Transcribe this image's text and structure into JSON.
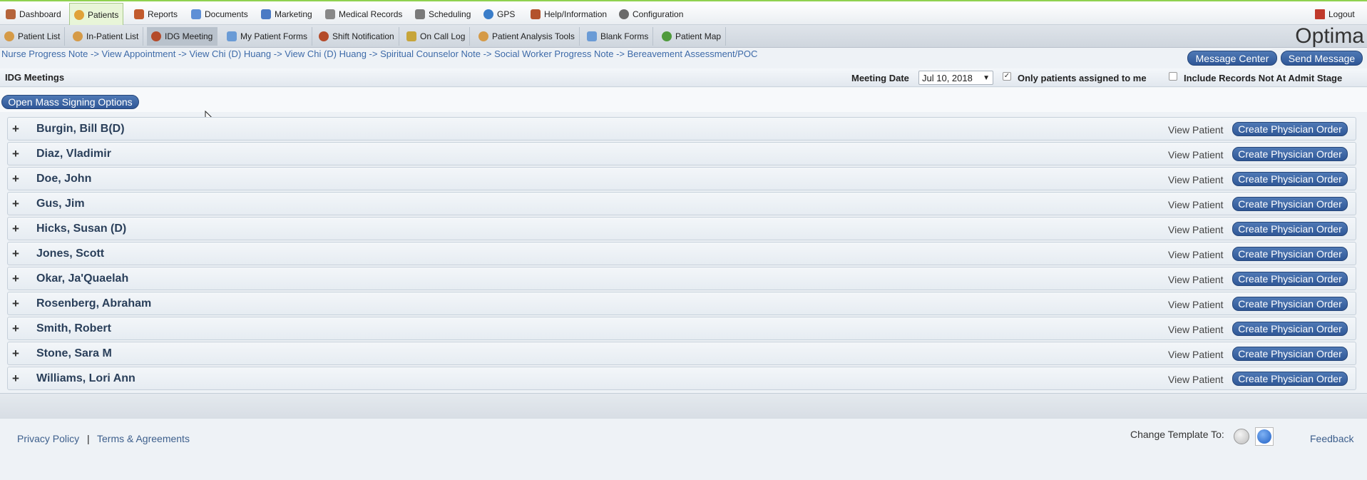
{
  "top_nav": [
    {
      "label": "Dashboard",
      "icon": "house-icon",
      "color": "#b5643b",
      "active": false
    },
    {
      "label": "Patients",
      "icon": "patient-icon",
      "color": "#e0a23a",
      "active": true
    },
    {
      "label": "Reports",
      "icon": "bar-chart-icon",
      "color": "#c25b2d",
      "active": false
    },
    {
      "label": "Documents",
      "icon": "documents-icon",
      "color": "#5e8fd6",
      "active": false
    },
    {
      "label": "Marketing",
      "icon": "marketing-icon",
      "color": "#4b7ac4",
      "active": false
    },
    {
      "label": "Medical Records",
      "icon": "medical-records-icon",
      "color": "#888888",
      "active": false
    },
    {
      "label": "Scheduling",
      "icon": "scheduling-icon",
      "color": "#7a7a7a",
      "active": false
    },
    {
      "label": "GPS",
      "icon": "globe-icon",
      "color": "#3a7dc9",
      "active": false
    },
    {
      "label": "Help/Information",
      "icon": "person-icon",
      "color": "#b3522c",
      "active": false
    },
    {
      "label": "Configuration",
      "icon": "gear-icon",
      "color": "#6a6a6a",
      "active": false
    }
  ],
  "logout_label": "Logout",
  "sub_nav": [
    {
      "label": "Patient List",
      "icon": "patient-list-icon",
      "color": "#d59a47",
      "active": false
    },
    {
      "label": "In-Patient List",
      "icon": "in-patient-icon",
      "color": "#d59a47",
      "active": false
    },
    {
      "label": "IDG Meeting",
      "icon": "idg-meeting-icon",
      "color": "#b44b2a",
      "active": true
    },
    {
      "label": "My Patient Forms",
      "icon": "forms-icon",
      "color": "#6a9bd6",
      "active": false
    },
    {
      "label": "Shift Notification",
      "icon": "shift-notification-icon",
      "color": "#b44b2a",
      "active": false
    },
    {
      "label": "On Call Log",
      "icon": "on-call-log-icon",
      "color": "#c7a53a",
      "active": false
    },
    {
      "label": "Patient Analysis Tools",
      "icon": "analysis-icon",
      "color": "#d59a47",
      "active": false
    },
    {
      "label": "Blank Forms",
      "icon": "blank-forms-icon",
      "color": "#6a9bd6",
      "active": false
    },
    {
      "label": "Patient Map",
      "icon": "map-icon",
      "color": "#4f9a3c",
      "active": false
    }
  ],
  "logo_text": "Optima",
  "breadcrumb": "Nurse Progress Note -> View Appointment -> View Chi (D) Huang -> View Chi (D) Huang -> Spiritual Counselor Note -> Social Worker Progress Note -> Bereavement Assessment/POC",
  "message_center_label": "Message Center",
  "send_message_label": "Send Message",
  "page_title": "IDG Meetings",
  "meeting_date_label": "Meeting Date",
  "meeting_date_value": "Jul 10, 2018",
  "only_assigned_label": "Only patients assigned to me",
  "only_assigned_checked": true,
  "include_records_label": "Include Records Not At Admit Stage",
  "include_records_checked": false,
  "mass_signing_label": "Open Mass Signing Options",
  "patients": [
    {
      "name": "Burgin, Bill B(D)"
    },
    {
      "name": "Diaz, Vladimir"
    },
    {
      "name": "Doe, John"
    },
    {
      "name": "Gus, Jim"
    },
    {
      "name": "Hicks, Susan (D)"
    },
    {
      "name": "Jones, Scott"
    },
    {
      "name": "Okar, Ja'Quaelah"
    },
    {
      "name": "Rosenberg, Abraham"
    },
    {
      "name": "Smith, Robert"
    },
    {
      "name": "Stone, Sara M"
    },
    {
      "name": "Williams, Lori Ann"
    }
  ],
  "view_patient_label": "View Patient",
  "create_order_label": "Create Physician Order",
  "expand_symbol": "+",
  "footer": {
    "privacy": "Privacy Policy",
    "separator": "|",
    "terms": "Terms & Agreements",
    "change_template": "Change Template To:",
    "feedback": "Feedback"
  }
}
